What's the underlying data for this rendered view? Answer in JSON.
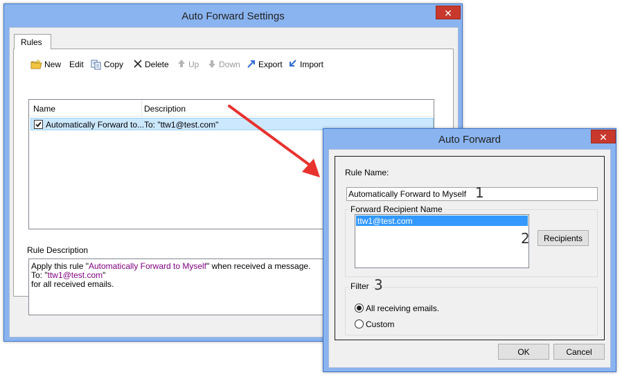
{
  "main_window": {
    "title": "Auto Forward Settings",
    "tab_label": "Rules",
    "toolbar": {
      "new": "New",
      "edit": "Edit",
      "copy": "Copy",
      "delete": "Delete",
      "up": "Up",
      "down": "Down",
      "export": "Export",
      "import": "Import"
    },
    "rules_list": {
      "columns": [
        "Name",
        "Description"
      ],
      "rows": [
        {
          "name": "Automatically Forward to...",
          "description": "To: \"ttw1@test.com\"",
          "checked": true
        }
      ]
    },
    "rule_description": {
      "label": "Rule Description",
      "line1_prefix": "Apply this rule \"",
      "line1_rule": "Automatically Forward to Myself",
      "line1_suffix": "\" when received a message.",
      "line2_prefix": "To: \"",
      "line2_email": "ttw1@test.com",
      "line2_suffix": "\"",
      "line3": "for all received emails."
    }
  },
  "dialog": {
    "title": "Auto Forward",
    "rule_name_label": "Rule Name:",
    "rule_name_value": "Automatically Forward to Myself",
    "recipient_group_label": "Forward Recipient Name",
    "recipients": [
      "ttw1@test.com"
    ],
    "recipients_button": "Recipients",
    "filter_group_label": "Filter",
    "filter_options": [
      {
        "label": "All receiving emails.",
        "selected": true
      },
      {
        "label": "Custom",
        "selected": false
      }
    ],
    "ok_button": "OK",
    "cancel_button": "Cancel"
  },
  "callouts": [
    "1",
    "2",
    "3"
  ],
  "colors": {
    "title_bar": "#8ab4f0",
    "close_button": "#c8382c",
    "selection_highlight": "#cce8ff",
    "list_selection": "#3399ff",
    "annotation_arrow": "#e8322e",
    "purple_text": "#800080"
  },
  "icons": {
    "new": "folder-new-icon",
    "copy": "copy-icon",
    "delete": "delete-x-icon",
    "up": "arrow-up-icon",
    "down": "arrow-down-icon",
    "export": "export-icon",
    "import": "import-icon",
    "close": "close-icon"
  }
}
